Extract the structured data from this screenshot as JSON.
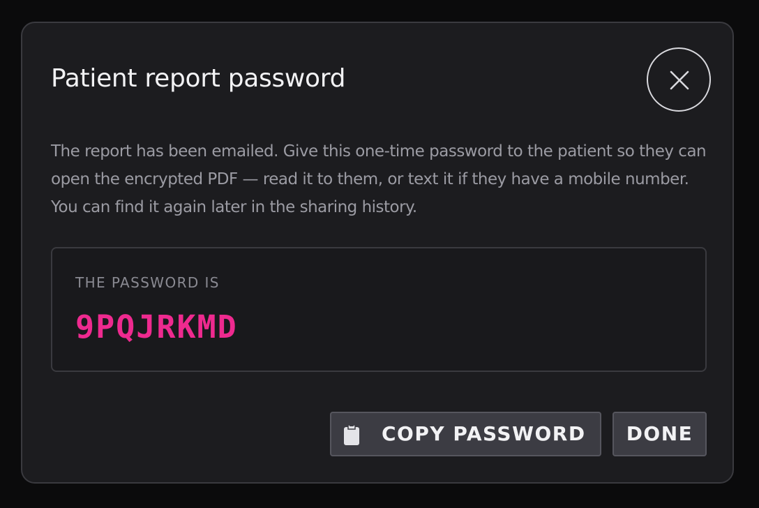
{
  "dialog": {
    "title": "Patient report password",
    "close_icon": "close-icon",
    "description": "The report has been emailed. Give this one-time password to the patient so they can open the encrypted PDF — read it to them, or text it if they have a mobile number. You can find it again later in the sharing history.",
    "password_label": "THE PASSWORD IS",
    "password_value": "9PQJRKMD",
    "copy_button": {
      "icon": "clipboard-icon",
      "label": "COPY PASSWORD"
    },
    "done_button": {
      "label": "DONE"
    }
  },
  "colors": {
    "background": "#0b0b0c",
    "dialog_bg": "#1c1c1f",
    "border": "#3a3a3f",
    "title_text": "#f2f2f4",
    "body_text": "#9b9ba3",
    "password_accent": "#ee2a8f",
    "button_bg": "#3c3c43"
  }
}
